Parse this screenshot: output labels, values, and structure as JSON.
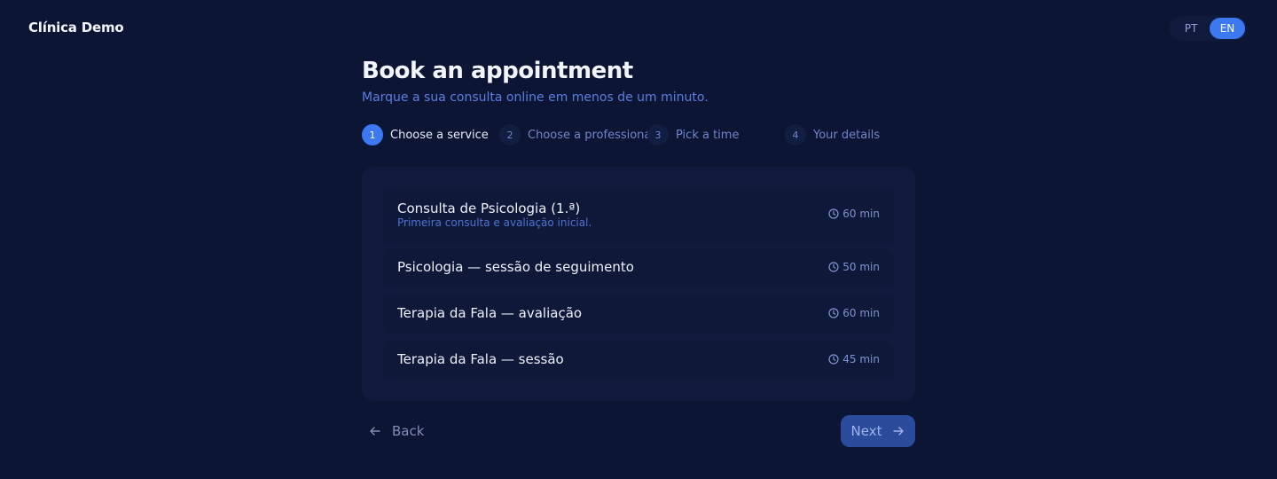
{
  "header": {
    "brand": "Clínica Demo",
    "languages": [
      "PT",
      "EN"
    ],
    "active_language": "EN"
  },
  "page": {
    "title": "Book an appointment",
    "subtitle": "Marque a sua consulta online em menos de um minuto."
  },
  "steps": [
    {
      "number": "1",
      "label": "Choose a service",
      "active": true
    },
    {
      "number": "2",
      "label": "Choose a professional",
      "active": false
    },
    {
      "number": "3",
      "label": "Pick a time",
      "active": false
    },
    {
      "number": "4",
      "label": "Your details",
      "active": false
    }
  ],
  "services": [
    {
      "name": "Consulta de Psicologia (1.ª)",
      "description": "Primeira consulta e avaliação inicial.",
      "duration": "60 min"
    },
    {
      "name": "Psicologia — sessão de seguimento",
      "description": "",
      "duration": "50 min"
    },
    {
      "name": "Terapia da Fala — avaliação",
      "description": "",
      "duration": "60 min"
    },
    {
      "name": "Terapia da Fala — sessão",
      "description": "",
      "duration": "45 min"
    }
  ],
  "nav": {
    "back_label": "Back",
    "next_label": "Next"
  },
  "icons": {
    "duration": "clock-icon",
    "back": "arrow-left-icon",
    "next": "arrow-right-icon"
  },
  "colors": {
    "background": "#0c1533",
    "accent": "#3c78f0",
    "subtitle": "#5b7ee0",
    "next_button": "#2b4c9c"
  }
}
